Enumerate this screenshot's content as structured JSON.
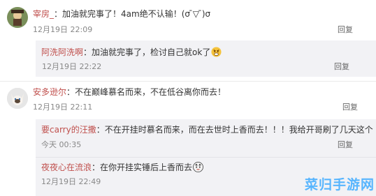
{
  "comments": [
    {
      "username": "宰房_",
      "separator": "：",
      "text": "加油就完事了！4am绝不认输！(σ ̄▽ ̄)σ",
      "time": "12月19日 22:09",
      "reply_label": "回复",
      "replies": [
        {
          "username": "阿洗阿洗啊",
          "separator": "：",
          "text": "加油就完事了，检讨自己就ok了",
          "time": "12月19日 22:22",
          "reply_label": "回复"
        }
      ]
    },
    {
      "username": "安多逊尔",
      "separator": "：",
      "text": "不在巅峰慕名而来，不在低谷离你而去！",
      "time": "12月19日 22:11",
      "reply_label": "回复",
      "replies": [
        {
          "username": "要carry的汪撒",
          "separator": "：",
          "text": "不在开挂时慕名而来，而在去世时上香而去！！！我给开哥刷了几天这个",
          "time": "今天 00:35",
          "reply_label": "回复"
        },
        {
          "username": "夜夜心在流浪",
          "separator": "：",
          "text": "在你开挂实锤后上香而去",
          "time": "12月19日 22:49",
          "reply_label": "回复"
        }
      ]
    }
  ],
  "watermark": "菜归手游网",
  "colors": {
    "username": "#c0504d",
    "reply_bg": "#f2f2f5",
    "time": "#888888"
  }
}
